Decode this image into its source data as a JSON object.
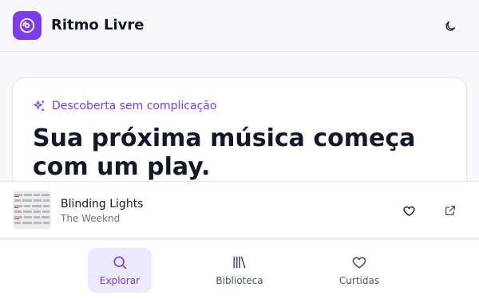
{
  "app": {
    "title": "Ritmo Livre",
    "accent_color": "#7c3aed",
    "logo_icon": "disc-icon",
    "theme_toggle_icon": "moon-icon"
  },
  "hero": {
    "eyebrow_icon": "sparkles-icon",
    "eyebrow": "Descoberta sem complicação",
    "headline": "Sua próxima música começa com um play."
  },
  "now_playing": {
    "title": "Blinding Lights",
    "artist": "The Weeknd",
    "like_icon": "heart-icon",
    "open_icon": "external-link-icon"
  },
  "nav": {
    "items": [
      {
        "label": "Explorar",
        "icon": "search-icon",
        "active": true
      },
      {
        "label": "Biblioteca",
        "icon": "library-icon",
        "active": false
      },
      {
        "label": "Curtidas",
        "icon": "heart-icon",
        "active": false
      }
    ]
  }
}
